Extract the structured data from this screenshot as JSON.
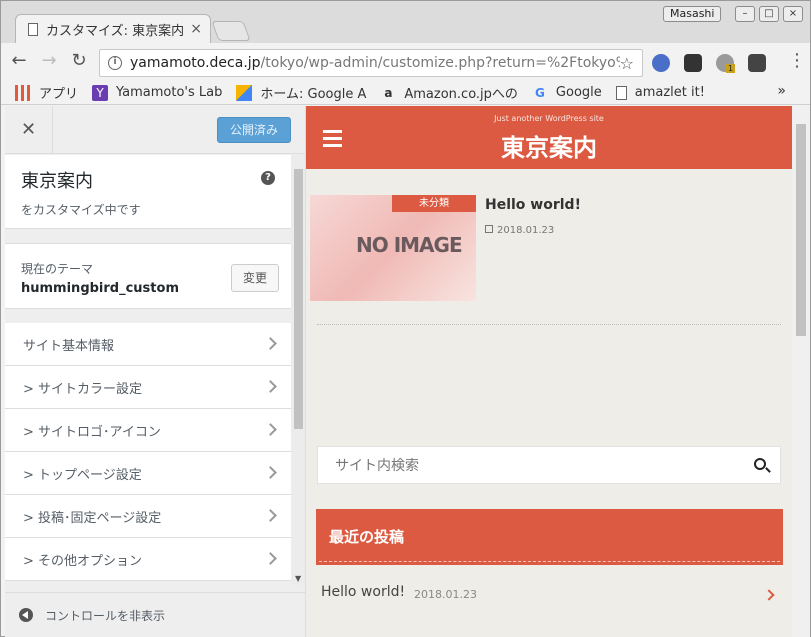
{
  "browser": {
    "tab_title": "カスタマイズ: 東京案内",
    "tab_close": "×",
    "profile_name": "Masashi",
    "url_host": "yamamoto.deca.jp",
    "url_path": "/tokyo/wp-admin/customize.php?return=%2Ftokyo%2F…",
    "ext_badge": "1"
  },
  "bookmarks": [
    {
      "label": "アプリ",
      "icon": "apps-grid-icon"
    },
    {
      "label": "Yamamoto's Lab",
      "icon": "yahoo-icon"
    },
    {
      "label": "ホーム: Google A",
      "icon": "google-ads-icon"
    },
    {
      "label": "Amazon.co.jpへの",
      "icon": "amazon-icon"
    },
    {
      "label": "Google",
      "icon": "google-icon"
    },
    {
      "label": "amazlet it!",
      "icon": "page-icon"
    }
  ],
  "bookmarks_more": "»",
  "customizer": {
    "close_label": "✕",
    "publish_label": "公開済み",
    "site_title": "東京案内",
    "site_sub": "をカスタマイズ中です",
    "help": "?",
    "theme_label": "現在のテーマ",
    "theme_name": "hummingbird_custom",
    "change_label": "変更",
    "menu": [
      "サイト基本情報",
      "> サイトカラー設定",
      "> サイトロゴ･アイコン",
      "> トップページ設定",
      "> 投稿･固定ページ設定",
      "> その他オプション"
    ],
    "footer_label": "コントロールを非表示"
  },
  "preview": {
    "tagline": "Just another WordPress site",
    "site_name": "東京案内",
    "noimage": "NO IMAGE",
    "category": "未分類",
    "post_title": "Hello world!",
    "post_date": "2018.01.23",
    "search_placeholder": "サイト内検索",
    "recent_heading": "最近の投稿",
    "recent_title": "Hello world!",
    "recent_date": "2018.01.23"
  },
  "colors": {
    "accent": "#dc5a41",
    "publish": "#5ba1d6"
  }
}
